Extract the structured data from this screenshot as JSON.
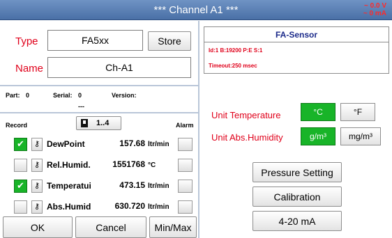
{
  "window": {
    "title": "*** Channel A1 ***",
    "voltage": "~ 0.0 V",
    "current": "~ 0 mA"
  },
  "left": {
    "type_label": "Type",
    "type_value": "FA5xx",
    "store_label": "Store",
    "name_label": "Name",
    "name_value": "Ch-A1",
    "part_label": "Part:",
    "part_value": "0",
    "serial_label": "Serial:",
    "serial_value": "0",
    "serial_extra": "---",
    "version_label": "Version:",
    "record_label": "Record",
    "range_label": "1..4",
    "alarm_label": "Alarm",
    "channels": [
      {
        "name": "DewPoint",
        "value": "157.68",
        "unit": "ltr/min",
        "recorded": true
      },
      {
        "name": "Rel.Humid.",
        "value": "1551768",
        "unit": "°C",
        "recorded": false
      },
      {
        "name": "Temperatui",
        "value": "473.15",
        "unit": "ltr/min",
        "recorded": true
      },
      {
        "name": "Abs.Humid",
        "value": "630.720",
        "unit": "ltr/min",
        "recorded": false
      }
    ],
    "ok_label": "OK",
    "cancel_label": "Cancel",
    "minmax_label": "Min/Max"
  },
  "right": {
    "sensor_title": "FA-Sensor",
    "id_line": "Id:1 B:19200 P:E S:1",
    "timeout_line": "Timeout:250 msec",
    "unit_temp_label": "Unit Temperature",
    "temp_c": "°C",
    "temp_f": "°F",
    "unit_hum_label": "Unit Abs.Humidity",
    "hum_g": "g/m³",
    "hum_mg": "mg/m³",
    "pressure_label": "Pressure Setting",
    "calibration_label": "Calibration",
    "ma_label": "4-20 mA"
  },
  "colors": {
    "title_bar": "#5a7fb5",
    "label_red": "#e0001a",
    "active_green": "#18b428",
    "sensor_blue": "#1b2a8a"
  },
  "icons": {
    "record_icon": "device-icon",
    "config_icon": "wrench-icon",
    "check_icon": "checkmark-icon"
  }
}
